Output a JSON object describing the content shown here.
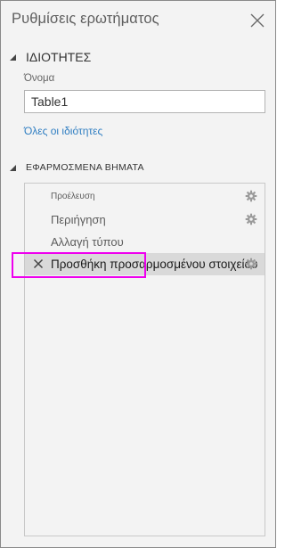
{
  "panel": {
    "title": "Ρυθμίσεις ερωτήματος",
    "close_icon": "close-icon"
  },
  "properties": {
    "header": "ΙΔΙΟΤΗΤΕΣ",
    "name_label": "Όνομα",
    "name_value": "Table1",
    "all_properties_link": "Όλες οι ιδιότητες",
    "link_color": "#2f7ec2"
  },
  "applied_steps": {
    "header": "ΕΦΑΡΜΟΣΜΕΝΑ ΒΗΜΑΤΑ",
    "steps": [
      {
        "label": "Προέλευση",
        "has_settings": true,
        "selected": false
      },
      {
        "label": "Περιήγηση",
        "has_settings": true,
        "selected": false
      },
      {
        "label": "Αλλαγή τύπου",
        "has_settings": false,
        "selected": false
      },
      {
        "label": "Προσθήκη προσαρμοσμένου στοιχείου",
        "has_settings": true,
        "selected": true
      }
    ]
  },
  "colors": {
    "highlight": "#ee00ee",
    "selected_row": "#d9d9d9",
    "panel_bg": "#f3f3f3"
  }
}
